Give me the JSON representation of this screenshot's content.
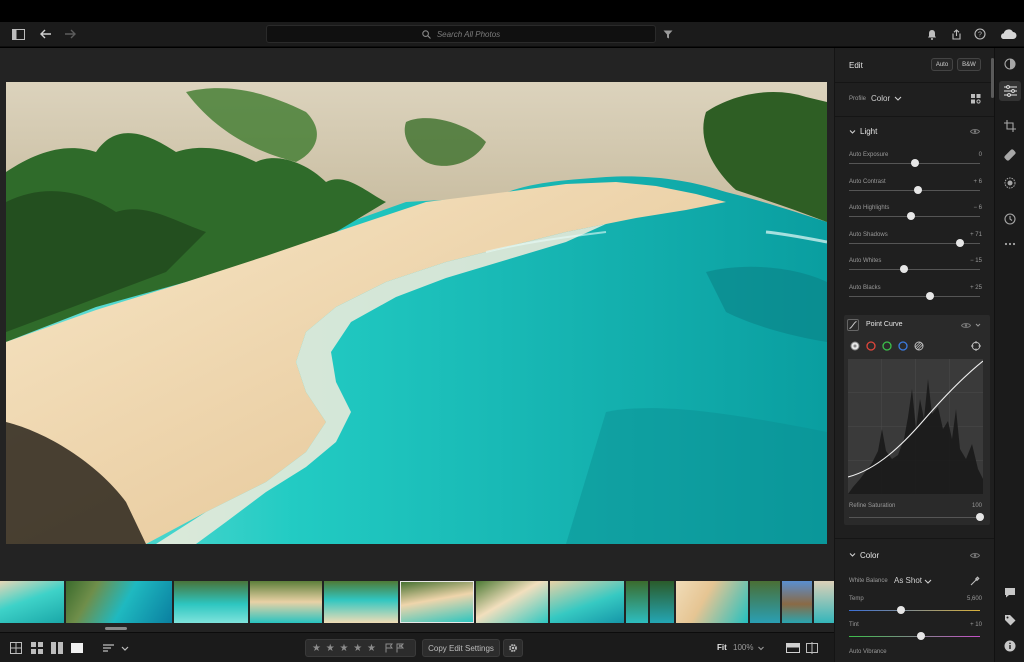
{
  "header": {
    "search_placeholder": "Search All Photos"
  },
  "filmstrip": {
    "thumbnail_count": 14,
    "selected_index": 5
  },
  "bottom_bar": {
    "rating_stars": "★ ★ ★ ★ ★",
    "copy_edit_label": "Copy Edit Settings",
    "fit_label": "Fit",
    "zoom_label": "100%"
  },
  "edit_panel": {
    "title": "Edit",
    "auto_label": "Auto",
    "bw_label": "B&W",
    "profile_label": "Profile",
    "profile_value": "Color",
    "light": {
      "title": "Light",
      "sliders": [
        {
          "label": "Auto Exposure",
          "value": "0",
          "position": 0.5
        },
        {
          "label": "Auto Contrast",
          "value": "+ 6",
          "position": 0.53
        },
        {
          "label": "Auto Highlights",
          "value": "− 6",
          "position": 0.47
        },
        {
          "label": "Auto Shadows",
          "value": "+ 71",
          "position": 0.85
        },
        {
          "label": "Auto Whites",
          "value": "− 15",
          "position": 0.42
        },
        {
          "label": "Auto Blacks",
          "value": "+ 25",
          "position": 0.62
        }
      ]
    },
    "point_curve": {
      "title": "Point Curve",
      "refine_label": "Refine Saturation",
      "refine_value": "100",
      "refine_position": 1.0
    },
    "color": {
      "title": "Color",
      "white_balance_label": "White Balance",
      "white_balance_value": "As Shot",
      "temp_label": "Temp",
      "temp_value": "5,600",
      "temp_position": 0.4,
      "tint_label": "Tint",
      "tint_value": "+ 10",
      "tint_position": 0.55,
      "vibrance_label": "Auto Vibrance"
    }
  },
  "colors": {
    "background": "#232323",
    "panel": "#1f1f1f",
    "toolbar": "#1b1b1b",
    "water": "#1fc8c0",
    "sand": "#efd2a8"
  }
}
